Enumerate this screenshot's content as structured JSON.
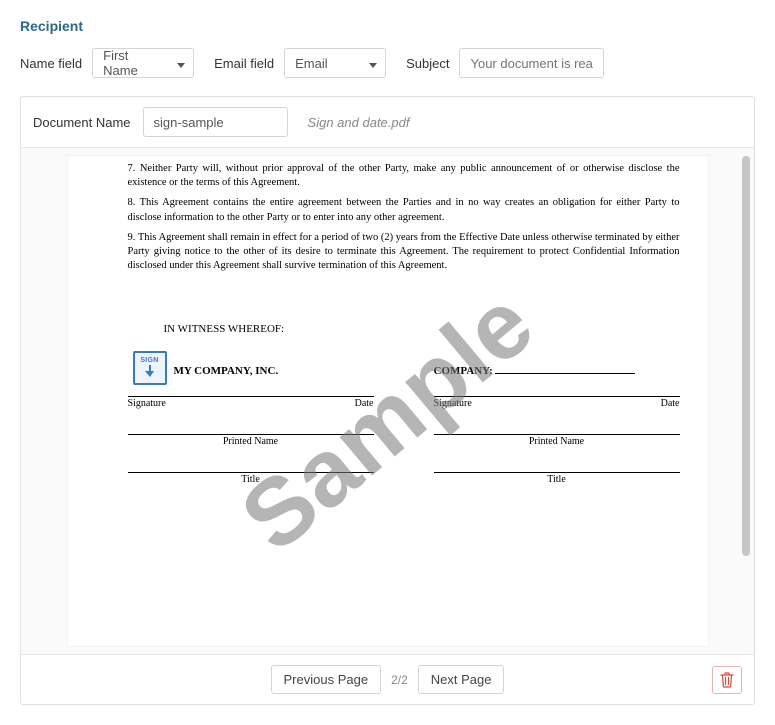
{
  "section_title": "Recipient",
  "fields": {
    "name_label": "Name field",
    "name_value": "First Name",
    "email_label": "Email field",
    "email_value": "Email",
    "subject_label": "Subject",
    "subject_placeholder": "Your document is ready"
  },
  "doc": {
    "name_label": "Document Name",
    "name_value": "sign-sample",
    "filename": "Sign and date.pdf"
  },
  "page_content": {
    "para7": "7.   Neither Party will, without prior approval of the other Party, make any public announcement of or otherwise disclose the existence or the terms of this Agreement.",
    "para8": "8.   This Agreement contains the entire agreement between the Parties and in no way creates an obligation for either Party to disclose information to the other Party or to enter into any other agreement.",
    "para9": "9.   This Agreement shall remain in effect for a period of two (2) years from the Effective Date unless otherwise terminated by either Party giving notice to the other of its desire to terminate this Agreement.  The requirement to protect Confidential Information disclosed under this Agreement shall survive termination of this Agreement.",
    "witness": "IN WITNESS WHEREOF:",
    "company1": "MY COMPANY, INC.",
    "company2_prefix": "COMPANY:",
    "sig_label": "Signature",
    "date_label": "Date",
    "printed_name_label": "Printed Name",
    "title_label": "Title",
    "sign_tag": "SIGN",
    "watermark": "Sample"
  },
  "pager": {
    "prev": "Previous Page",
    "indicator": "2/2",
    "next": "Next Page"
  }
}
